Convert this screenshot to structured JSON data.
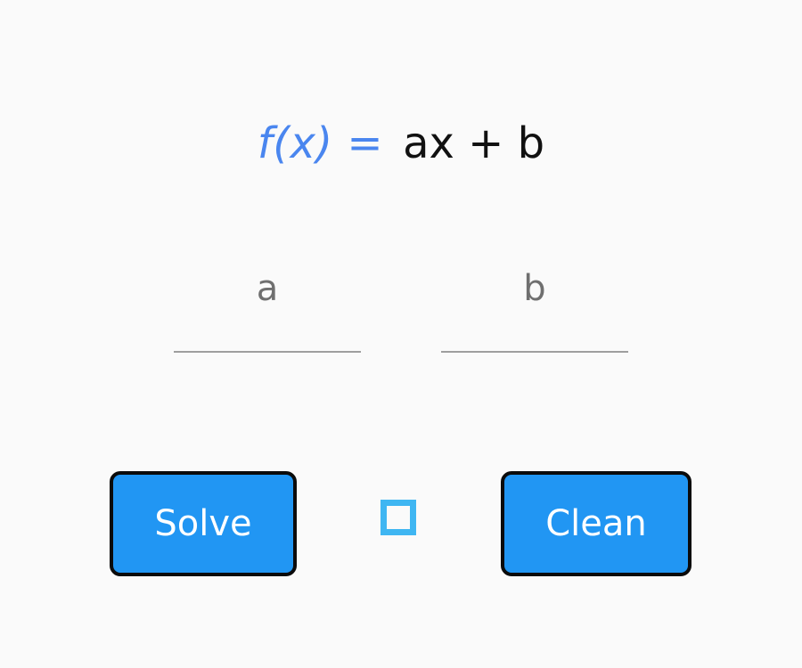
{
  "equation": {
    "function_label": "f(x) =",
    "expression": "ax + b"
  },
  "inputs": {
    "a": {
      "placeholder": "a",
      "value": ""
    },
    "b": {
      "placeholder": "b",
      "value": ""
    }
  },
  "buttons": {
    "solve_label": "Solve",
    "clean_label": "Clean"
  },
  "indicator": {
    "icon": "square-outline-icon",
    "color": "#3fb6f2"
  },
  "colors": {
    "accent": "#4a86ef",
    "button_fill": "#2196f3",
    "button_border": "#0b0b0b",
    "underline": "#9e9e9e",
    "background": "#fafafa"
  }
}
